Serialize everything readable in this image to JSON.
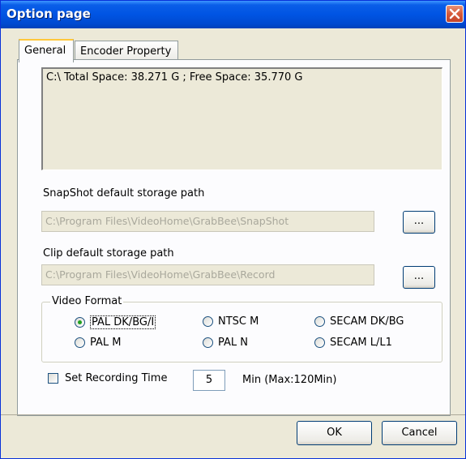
{
  "window": {
    "title": "Option page"
  },
  "tabs": [
    {
      "label": "General",
      "active": true
    },
    {
      "label": "Encoder Property",
      "active": false
    }
  ],
  "general": {
    "disk_info": "C:\\ Total Space: 38.271 G ;   Free  Space: 35.770 G",
    "snapshot": {
      "label": "SnapShot default storage path",
      "value": "C:\\Program Files\\VideoHome\\GrabBee\\SnapShot",
      "browse_label": "..."
    },
    "clip": {
      "label": "Clip default storage path",
      "value": "C:\\Program Files\\VideoHome\\GrabBee\\Record",
      "browse_label": "..."
    },
    "video_format": {
      "legend": "Video Format",
      "options": [
        {
          "label": "PAL DK/BG/I",
          "checked": true
        },
        {
          "label": "NTSC M",
          "checked": false
        },
        {
          "label": "SECAM DK/BG",
          "checked": false
        },
        {
          "label": "PAL M",
          "checked": false
        },
        {
          "label": "PAL N",
          "checked": false
        },
        {
          "label": "SECAM L/L1",
          "checked": false
        }
      ]
    },
    "recording": {
      "checkbox_label": "Set Recording Time",
      "checked": false,
      "minutes": "5",
      "unit_label": "Min (Max:120Min)"
    }
  },
  "buttons": {
    "ok": "OK",
    "cancel": "Cancel"
  },
  "colors": {
    "titlebar": "#0054e3",
    "dialog_bg": "#ece9d8",
    "panel_bg": "#fcfcfe",
    "radio_dot": "#21a121",
    "close_button": "#d65a3a"
  }
}
